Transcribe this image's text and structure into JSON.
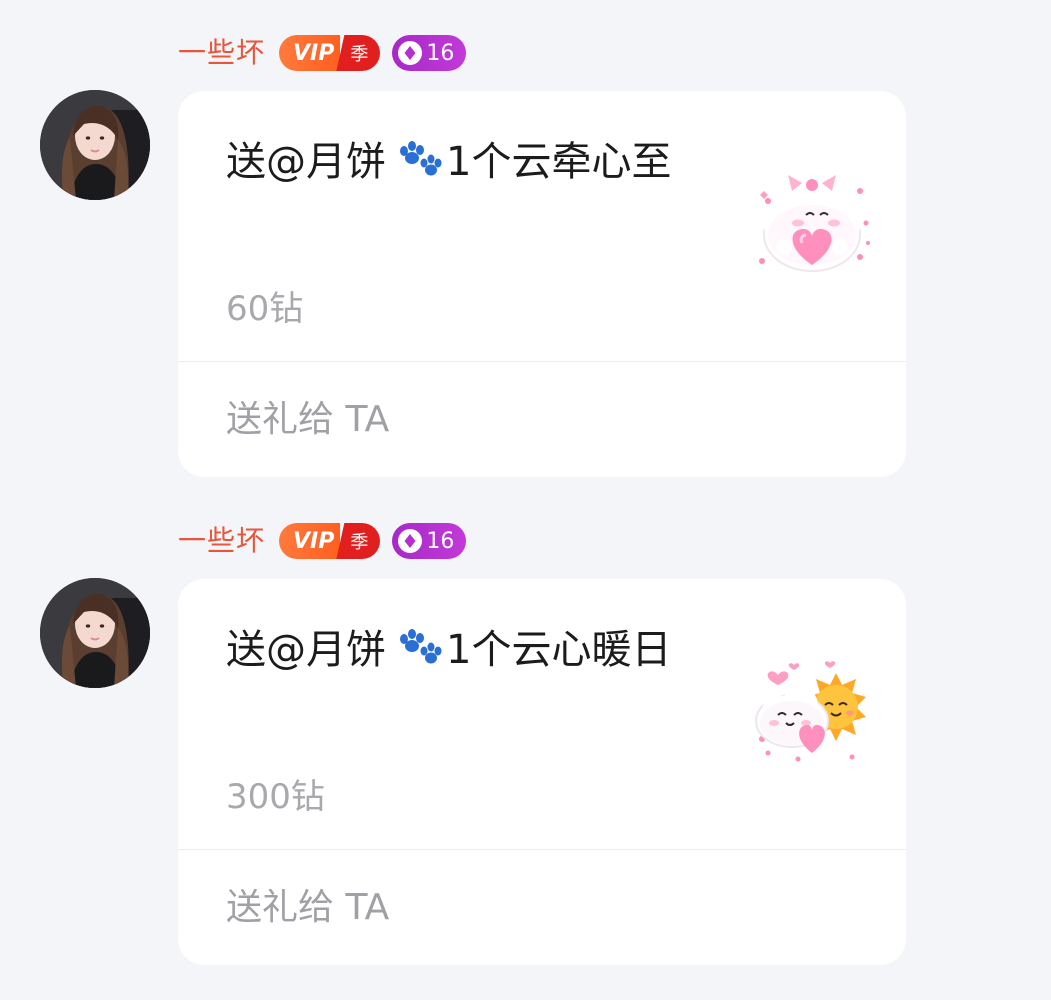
{
  "messages": [
    {
      "sender": {
        "name": "一些坏",
        "vip_label": "VIP",
        "vip_tier": "季",
        "level": "16"
      },
      "gift": {
        "text_before_icon": "送@月饼",
        "text_after_icon": "1个云牵心至",
        "price": "60钻",
        "image": "cloud-heart-bow-gift"
      },
      "action": "送礼给 TA"
    },
    {
      "sender": {
        "name": "一些坏",
        "vip_label": "VIP",
        "vip_tier": "季",
        "level": "16"
      },
      "gift": {
        "text_before_icon": "送@月饼",
        "text_after_icon": "1个云心暖日",
        "price": "300钻",
        "image": "cloud-sun-heart-gift"
      },
      "action": "送礼给 TA"
    }
  ],
  "colors": {
    "sender_name": "#e8553b",
    "vip_orange": "#ff6a2b",
    "vip_red": "#e21f1f",
    "level_purple": "#b52fd0",
    "price_gray": "#a8a8ad",
    "background": "#f4f5f9"
  },
  "icons": [
    "paw-icon",
    "diamond-icon"
  ]
}
